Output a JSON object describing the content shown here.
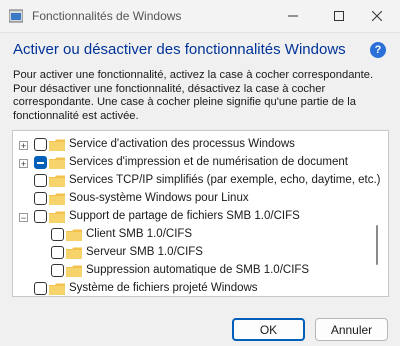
{
  "window": {
    "title": "Fonctionnalités de Windows"
  },
  "heading": "Activer ou désactiver des fonctionnalités Windows",
  "help_icon": "?",
  "description": "Pour activer une fonctionnalité, activez la case à cocher correspondante. Pour désactiver une fonctionnalité, désactivez la case à cocher correspondante. Une case à cocher pleine signifie qu'une partie de la fonctionnalité est activée.",
  "features": [
    {
      "label": "Service d'activation des processus Windows",
      "expander": "+",
      "state": "unchecked"
    },
    {
      "label": "Services d'impression et de numérisation de document",
      "expander": "+",
      "state": "partial"
    },
    {
      "label": "Services TCP/IP simplifiés (par exemple, echo, daytime, etc.)",
      "expander": "",
      "state": "unchecked"
    },
    {
      "label": "Sous-système Windows pour Linux",
      "expander": "",
      "state": "unchecked"
    },
    {
      "label": "Support de partage de fichiers SMB 1.0/CIFS",
      "expander": "−",
      "state": "unchecked"
    },
    {
      "label": "Client SMB 1.0/CIFS",
      "expander": "",
      "state": "unchecked"
    },
    {
      "label": "Serveur SMB 1.0/CIFS",
      "expander": "",
      "state": "unchecked"
    },
    {
      "label": "Suppression automatique de SMB 1.0/CIFS",
      "expander": "",
      "state": "unchecked"
    },
    {
      "label": "Système de fichiers projeté Windows",
      "expander": "",
      "state": "unchecked"
    }
  ],
  "buttons": {
    "ok": "OK",
    "cancel": "Annuler"
  },
  "colors": {
    "heading": "#003399",
    "accent": "#005fb8",
    "folder": "#f2c14e"
  }
}
